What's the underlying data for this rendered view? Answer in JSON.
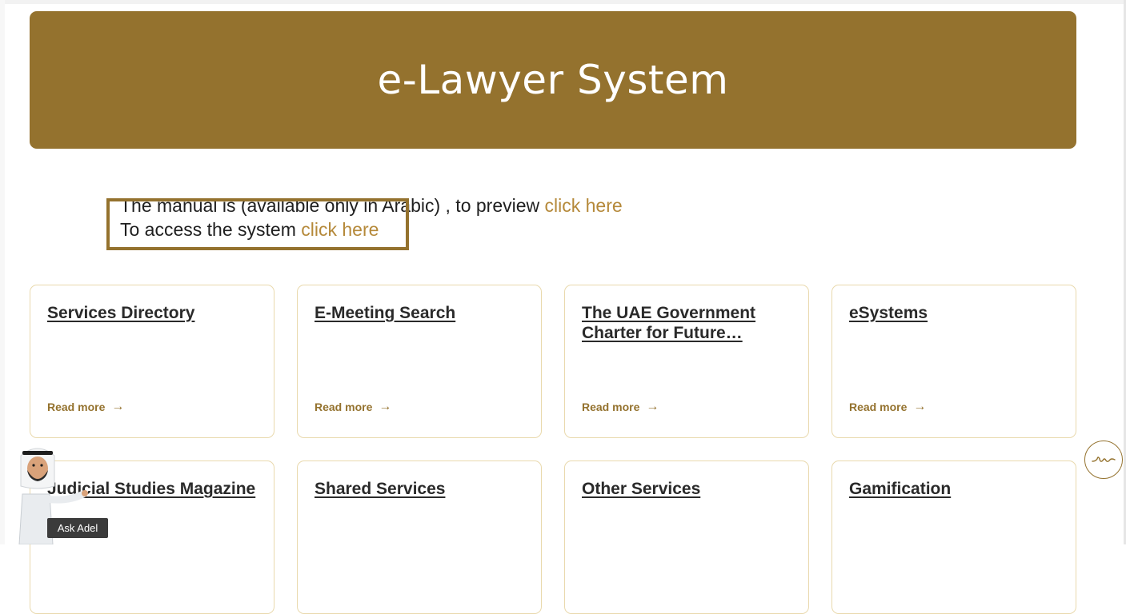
{
  "hero": {
    "title": "e-Lawyer System"
  },
  "intro": {
    "manual_text": "The manual is (available only in Arabic) , to preview ",
    "manual_link": "click here",
    "access_text": "To access the system ",
    "access_link": "click here"
  },
  "cards": [
    {
      "title": "Services Directory",
      "more": "Read more"
    },
    {
      "title": "E-Meeting Search",
      "more": "Read more"
    },
    {
      "title": "The UAE Government Charter for Future…",
      "more": "Read more"
    },
    {
      "title": "eSystems",
      "more": "Read more"
    },
    {
      "title": "Judicial Studies Magazine"
    },
    {
      "title": "Shared Services"
    },
    {
      "title": "Other Services"
    },
    {
      "title": "Gamification"
    }
  ],
  "assistant": {
    "label": "Ask Adel"
  },
  "colors": {
    "brand": "#94722e",
    "link": "#b5893a",
    "card_border": "#e9d9ad"
  }
}
